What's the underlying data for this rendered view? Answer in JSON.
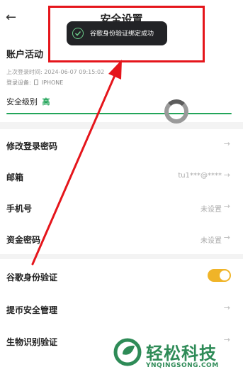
{
  "header": {
    "back_icon": "back-arrow-icon",
    "title": "安全设置"
  },
  "account": {
    "title": "账户活动",
    "last_login_label": "上次登录时间:",
    "last_login_value": "2024-06-07 09:15:02",
    "device_label": "登录设备:",
    "device_value": "IPHONE",
    "level_label": "安全级别",
    "level_value": "高",
    "level_color": "#23a55a"
  },
  "settings": {
    "group1": [
      {
        "label": "修改登录密码",
        "value": ""
      },
      {
        "label": "邮箱",
        "value": "tu1***@****"
      },
      {
        "label": "手机号",
        "value": "未设置"
      },
      {
        "label": "资金密码",
        "value": "未设置"
      }
    ],
    "group2": [
      {
        "label": "谷歌身份验证",
        "toggle_on": true
      },
      {
        "label": "提币安全管理"
      },
      {
        "label": "生物识别验证"
      }
    ]
  },
  "toast": {
    "icon": "check-circle-icon",
    "text": "谷歌身份验证绑定成功"
  },
  "colors": {
    "toggle": "#f0b428",
    "annotation": "#e5151b",
    "watermark": "#2e8b57"
  },
  "watermark": {
    "text": "轻松科技",
    "domain": "YNQINGSONG.COM"
  }
}
